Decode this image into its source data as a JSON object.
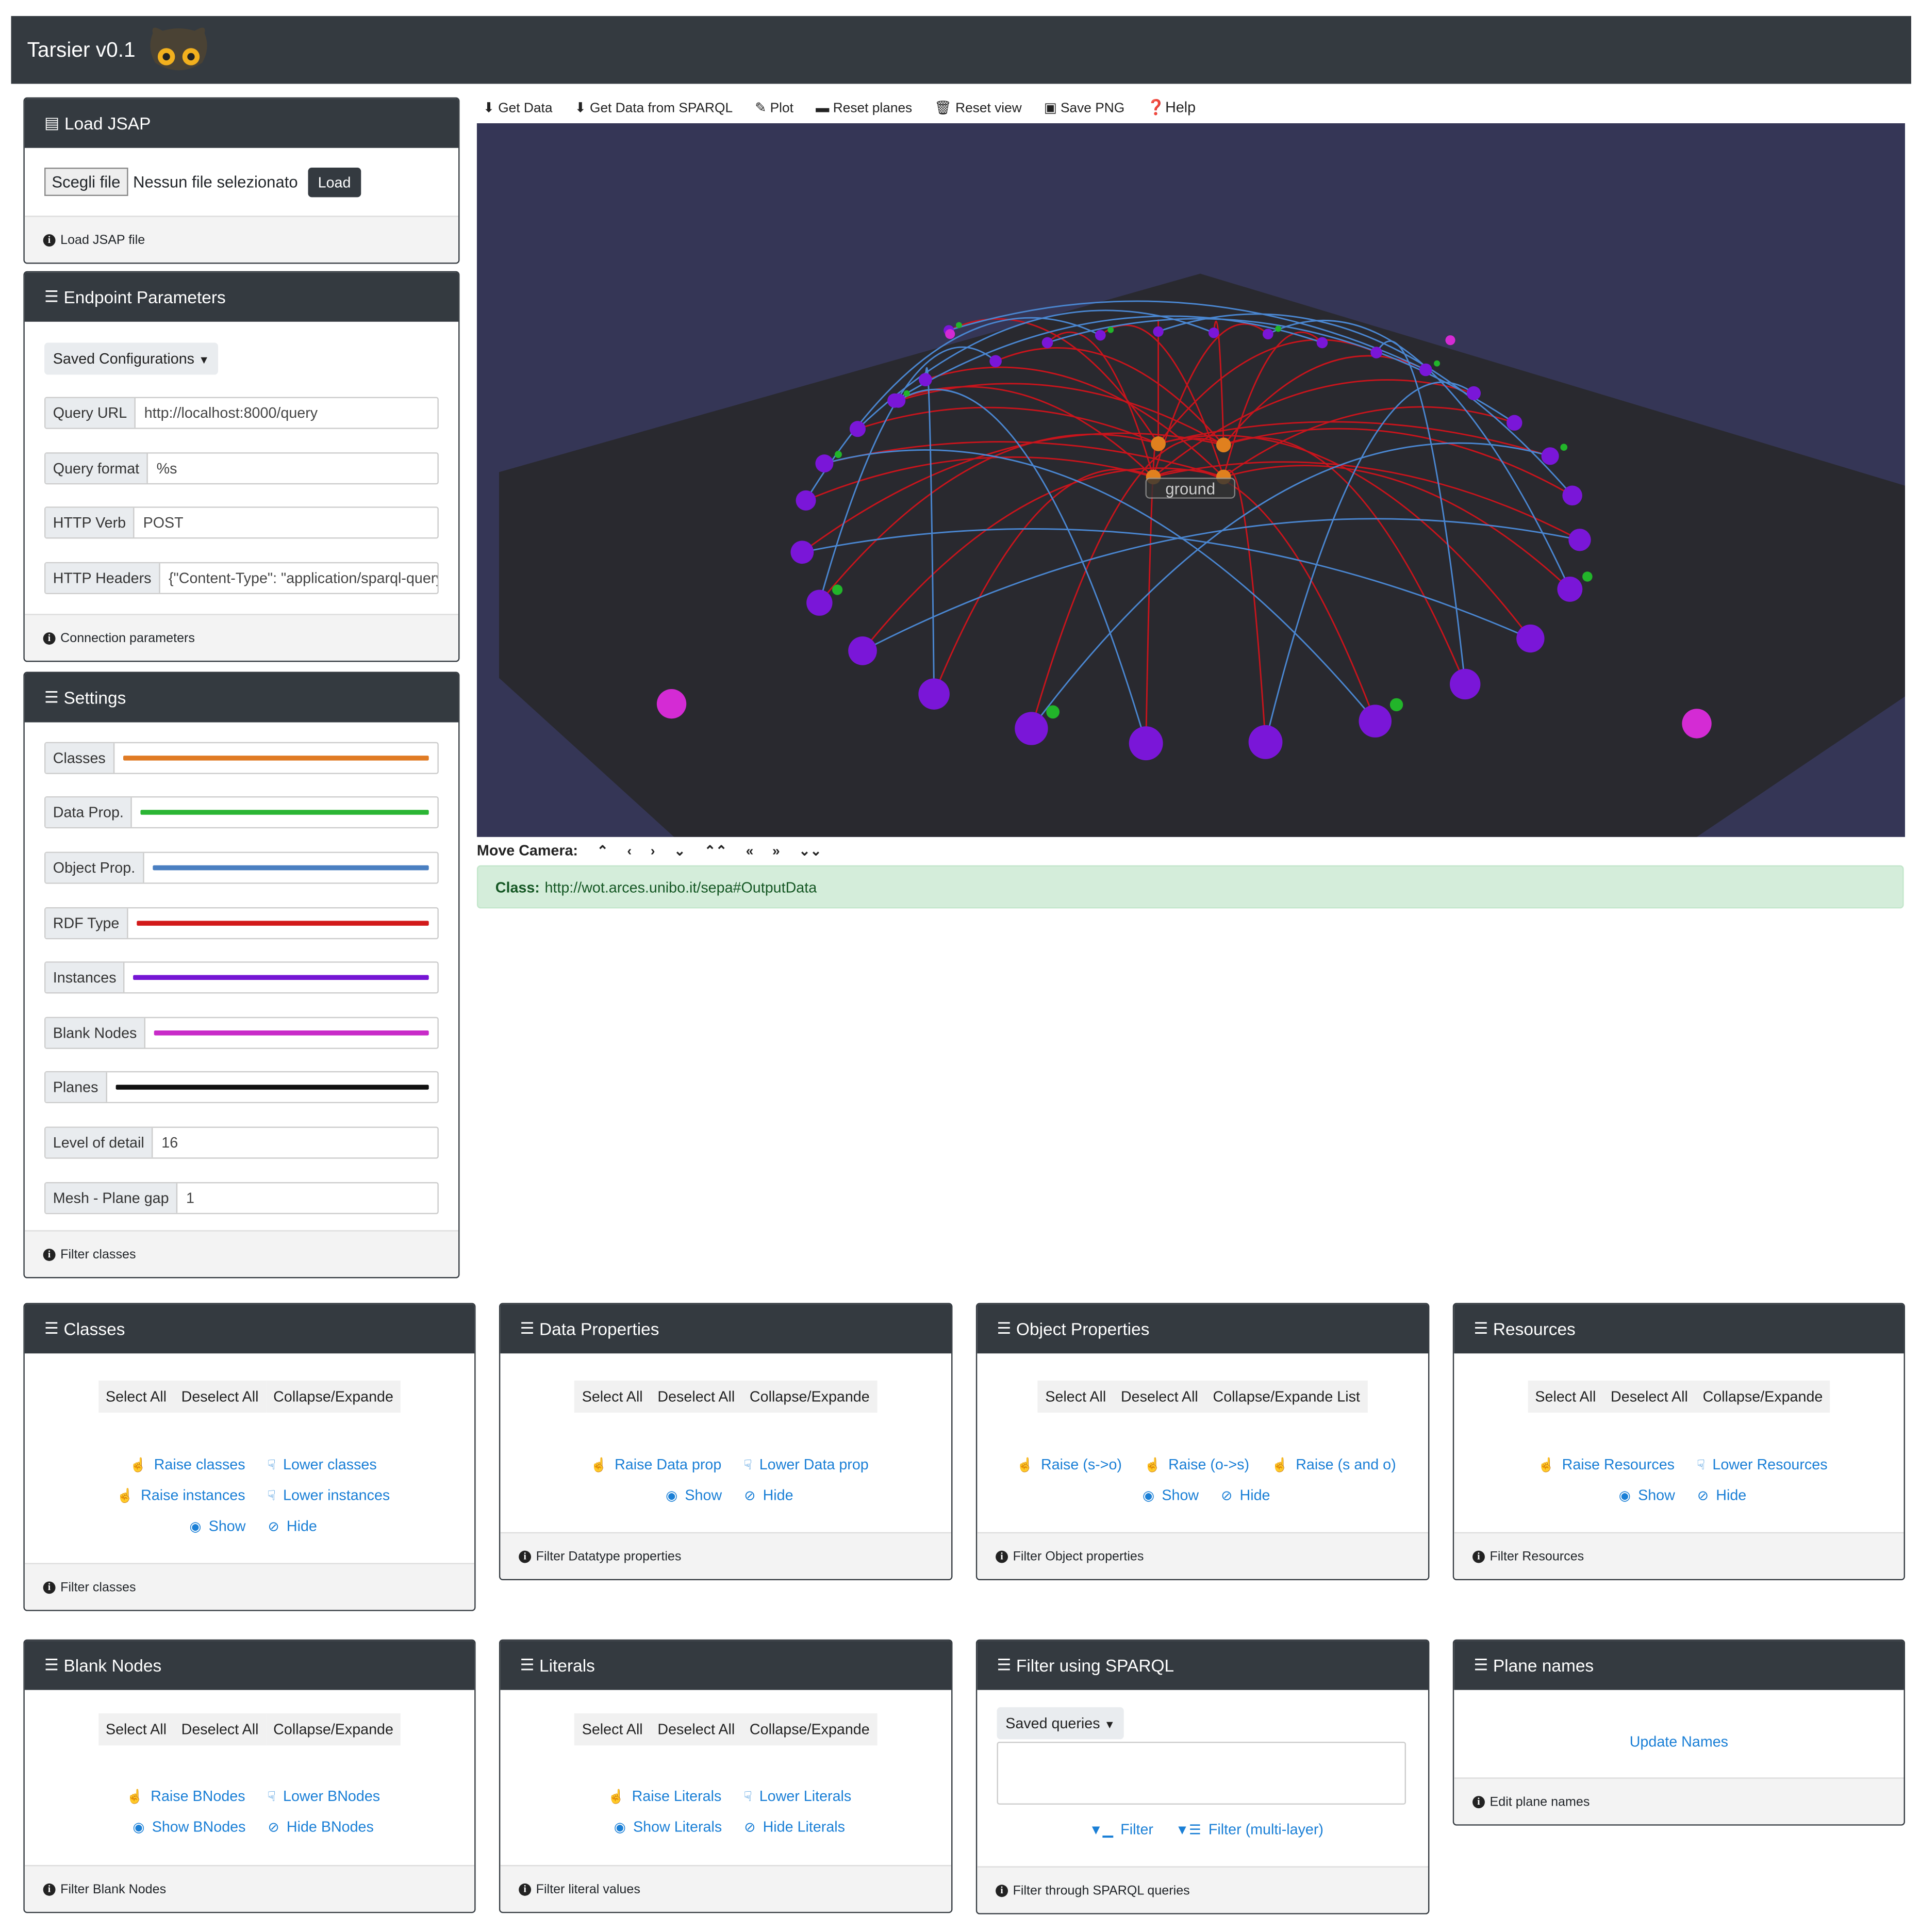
{
  "app": {
    "title": "Tarsier v0.1"
  },
  "load_jsap": {
    "title": "Load JSAP",
    "choose_label": "Scegli file",
    "no_file": "Nessun file selezionato",
    "load_label": "Load",
    "footer": "Load JSAP file"
  },
  "endpoint": {
    "title": "Endpoint Parameters",
    "saved_configs": "Saved Configurations",
    "fields": [
      {
        "label": "Query URL",
        "value": "http://localhost:8000/query"
      },
      {
        "label": "Query format",
        "value": "%s"
      },
      {
        "label": "HTTP Verb",
        "value": "POST"
      },
      {
        "label": "HTTP Headers",
        "value": "{\"Content-Type\": \"application/sparql-query\","
      }
    ],
    "footer": "Connection parameters"
  },
  "settings": {
    "title": "Settings",
    "colors": [
      {
        "label": "Classes",
        "color": "#e07b24"
      },
      {
        "label": "Data Prop.",
        "color": "#2bb534"
      },
      {
        "label": "Object Prop.",
        "color": "#4a7fc1"
      },
      {
        "label": "RDF Type",
        "color": "#d21a1a"
      },
      {
        "label": "Instances",
        "color": "#7515d4"
      },
      {
        "label": "Blank Nodes",
        "color": "#c82bc8"
      },
      {
        "label": "Planes",
        "color": "#111111"
      }
    ],
    "level_label": "Level of detail",
    "level_value": "16",
    "gap_label": "Mesh - Plane gap",
    "gap_value": "1",
    "footer": "Filter classes"
  },
  "toolbar": {
    "get_data": "Get Data",
    "get_sparql": "Get Data from SPARQL",
    "plot": "Plot",
    "reset_planes": "Reset planes",
    "reset_view": "Reset view",
    "save_png": "Save PNG",
    "help": "Help"
  },
  "scene": {
    "ground_label": "ground",
    "background": "#353656"
  },
  "camera": {
    "label": "Move Camera:",
    "buttons": [
      "⌃",
      "‹",
      "›",
      "⌄",
      "⌃⌃",
      "«",
      "»",
      "⌄⌄"
    ]
  },
  "selection": {
    "key": "Class:",
    "value": "http://wot.arces.unibo.it/sepa#OutputData"
  },
  "panels": {
    "classes": {
      "title": "Classes",
      "buttons": [
        "Select All",
        "Deselect All",
        "Collapse/Expande"
      ],
      "links": [
        [
          "Raise classes",
          "Lower classes"
        ],
        [
          "Raise instances",
          "Lower instances"
        ],
        [
          "Show",
          "Hide"
        ]
      ],
      "footer": "Filter classes"
    },
    "dataprops": {
      "title": "Data Properties",
      "buttons": [
        "Select All",
        "Deselect All",
        "Collapse/Expande"
      ],
      "links": [
        [
          "Raise Data prop",
          "Lower Data prop"
        ],
        [
          "Show",
          "Hide"
        ]
      ],
      "footer": "Filter Datatype properties"
    },
    "objprops": {
      "title": "Object Properties",
      "buttons": [
        "Select All",
        "Deselect All",
        "Collapse/Expande List"
      ],
      "links": [
        [
          "Raise (s->o)",
          "Raise (o->s)",
          "Raise (s and o)"
        ],
        [
          "Show",
          "Hide"
        ]
      ],
      "footer": "Filter Object properties"
    },
    "resources": {
      "title": "Resources",
      "buttons": [
        "Select All",
        "Deselect All",
        "Collapse/Expande"
      ],
      "links": [
        [
          "Raise Resources",
          "Lower Resources"
        ],
        [
          "Show",
          "Hide"
        ]
      ],
      "footer": "Filter Resources"
    },
    "bnodes": {
      "title": "Blank Nodes",
      "buttons": [
        "Select All",
        "Deselect All",
        "Collapse/Expande"
      ],
      "links": [
        [
          "Raise BNodes",
          "Lower BNodes"
        ],
        [
          "Show BNodes",
          "Hide BNodes"
        ]
      ],
      "footer": "Filter Blank Nodes"
    },
    "literals": {
      "title": "Literals",
      "buttons": [
        "Select All",
        "Deselect All",
        "Collapse/Expande"
      ],
      "links": [
        [
          "Raise Literals",
          "Lower Literals"
        ],
        [
          "Show Literals",
          "Hide Literals"
        ]
      ],
      "footer": "Filter literal values"
    },
    "sparql": {
      "title": "Filter using SPARQL",
      "saved_queries": "Saved queries",
      "query_text": "",
      "filter": "Filter",
      "filter_multi": "Filter (multi-layer)",
      "footer": "Filter through SPARQL queries"
    },
    "planes": {
      "title": "Plane names",
      "update": "Update Names",
      "footer": "Edit plane names"
    }
  }
}
